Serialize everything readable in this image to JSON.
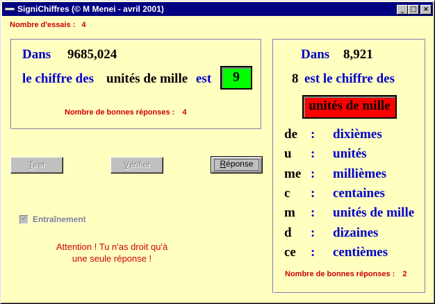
{
  "window": {
    "title": "SigniChiffres (© M Menei - avril 2001)",
    "controls": {
      "minimize": "_",
      "maximize": "□",
      "close": "×"
    }
  },
  "header": {
    "essais_label": "Nombre d'essais :",
    "essais_value": "4"
  },
  "left_panel": {
    "dans_label": "Dans",
    "number": "9685,024",
    "phrase_start": "le chiffre des",
    "target_position": "unités de mille",
    "phrase_end": "est",
    "answer": "9",
    "good_answers_label": "Nombre de bonnes réponses :",
    "good_answers_value": "4"
  },
  "buttons": {
    "tirer": "Tirer",
    "verifier": "Vérifier",
    "reponse": "Réponse"
  },
  "training": {
    "label": "Entraînement",
    "checked": true
  },
  "warning": {
    "line1": "Attention ! Tu n'as droit qu'à",
    "line2": "une seule réponse !"
  },
  "right_panel": {
    "dans_label": "Dans",
    "number": "8,921",
    "digit": "8",
    "phrase": "est le chiffre des",
    "answer_box": "unités de mille",
    "codes": [
      {
        "abbr": "de",
        "colon": ":",
        "name": "dixièmes"
      },
      {
        "abbr": "u",
        "colon": ":",
        "name": "unités"
      },
      {
        "abbr": "me",
        "colon": ":",
        "name": "millièmes"
      },
      {
        "abbr": "c",
        "colon": ":",
        "name": "centaines"
      },
      {
        "abbr": "m",
        "colon": ":",
        "name": "unités de mille"
      },
      {
        "abbr": "d",
        "colon": ":",
        "name": "dizaines"
      },
      {
        "abbr": "ce",
        "colon": ":",
        "name": "centièmes"
      }
    ],
    "good_answers_label": "Nombre de bonnes réponses :",
    "good_answers_value": "2"
  },
  "colors": {
    "background": "#ffffc0",
    "titlebar": "#000080",
    "blue_text": "#0000cc",
    "red_text": "#cc0000",
    "answer_green": "#00ff00",
    "answer_red": "#ff0000"
  }
}
